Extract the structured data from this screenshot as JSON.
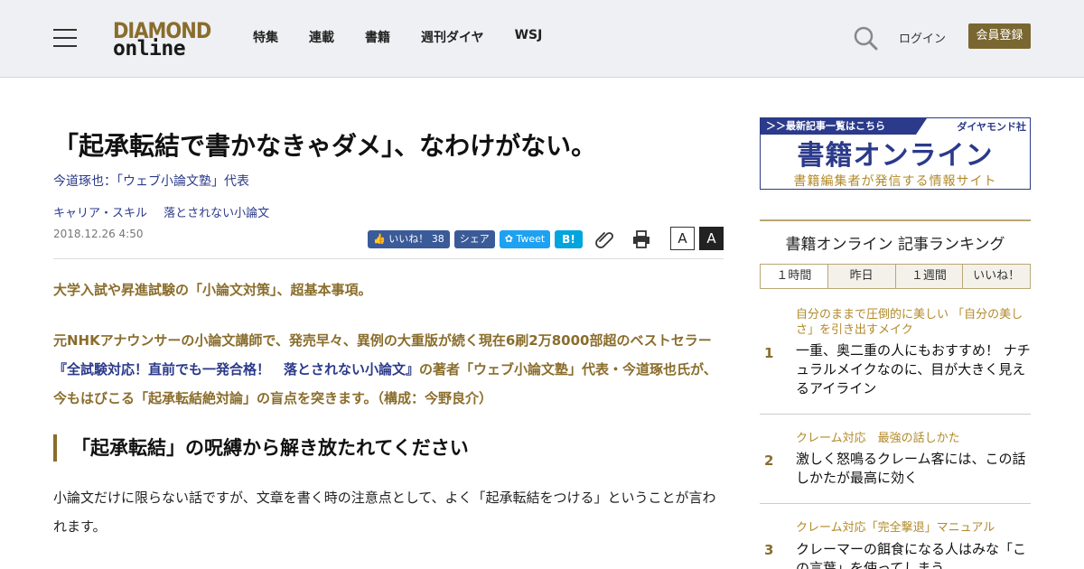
{
  "header": {
    "logo_top": "DIAMOND",
    "logo_bottom": "online",
    "nav": [
      "特集",
      "連載",
      "書籍",
      "週刊ダイヤ",
      "WSJ"
    ],
    "login": "ログイン",
    "register": "会員登録",
    "search_icon": "search-icon",
    "menu_icon": "hamburger-icon"
  },
  "article": {
    "title": "「起承転結で書かなきゃダメ」、なわけがない。",
    "author": "今道琢也：「ウェブ小論文塾」代表",
    "categories": [
      "キャリア・スキル",
      "落とされない小論文"
    ],
    "date": "2018.12.26 4:50",
    "share": {
      "like": "いいね！",
      "like_count": "38",
      "share": "シェア",
      "tweet": "Tweet",
      "hatena": "B!"
    },
    "font_small": "A",
    "font_large": "A",
    "lead1": "大学入試や昇進試験の「小論文対策」、超基本事項。",
    "lead2_pre": "元NHKアナウンサーの小論文講師で、発売早々、異例の大重版が続く現在6刷2万8000部超のベストセラー",
    "lead2_book": "『全試験対応！直前でも一発合格！　落とされない小論文』",
    "lead2_post": "の著者「ウェブ小論文塾」代表・今道琢也氏が、今もはびこる「起承転結絶対論」の盲点を突きます。（構成：今野良介）",
    "heading": "「起承転結」の呪縛から解き放たれてください",
    "body1": "小論文だけに限らない話ですが、文章を書く時の注意点として、よく「起承転結をつける」ということが言われます。"
  },
  "sidebar": {
    "banner": {
      "top_left": "＞＞最新記事一覧はこちら",
      "top_right": "ダイヤモンド社",
      "main": "書籍オンライン",
      "sub": "書籍編集者が発信する情報サイト"
    },
    "ranking_title": "書籍オンライン 記事ランキング",
    "tabs": [
      "１時間",
      "昨日",
      "１週間",
      "いいね！"
    ],
    "items": [
      {
        "rank": "1",
        "series": "自分のままで圧倒的に美しい 「自分の美しさ」を引き出すメイク",
        "headline": "一重、奥二重の人にもおすすめ！ ナチュラルメイクなのに、目が大きく見えるアイライン"
      },
      {
        "rank": "2",
        "series": "クレーム対応　最強の話しかた",
        "headline": "激しく怒鳴るクレーム客には、この話しかたが最高に効く"
      },
      {
        "rank": "3",
        "series": "クレーム対応「完全撃退」マニュアル",
        "headline": "クレーマーの餌食になる人はみな「この言葉」を使ってしまう"
      }
    ]
  }
}
